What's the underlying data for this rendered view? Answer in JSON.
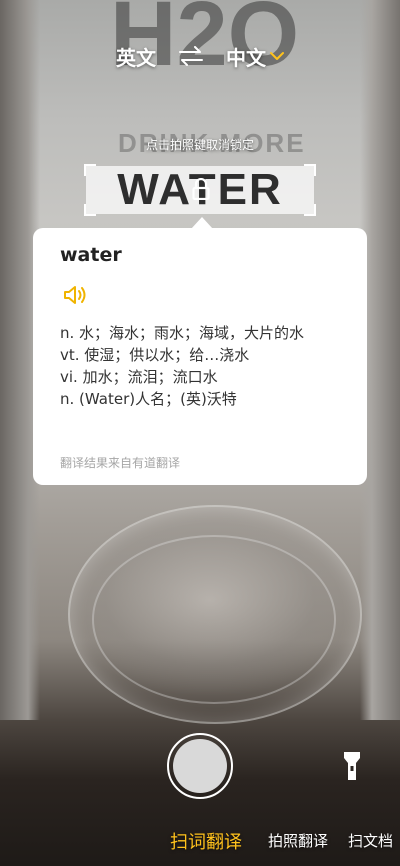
{
  "lang": {
    "source": "英文",
    "target": "中文"
  },
  "hint": "点击拍照键取消锁定",
  "scan_word": "WATER",
  "card": {
    "word": "water",
    "definitions": [
      "n. 水；海水；雨水；海域，大片的水",
      "vt. 使湿；供以水；给…浇水",
      "vi. 加水；流泪；流口水",
      "n. (Water)人名；(英)沃特"
    ],
    "source": "翻译结果来自有道翻译"
  },
  "background_print": {
    "formula": "H2O",
    "top_text": "DRINK MORE"
  },
  "modes": [
    "扫词翻译",
    "拍照翻译",
    "扫文档"
  ],
  "colors": {
    "accent": "#ffc21c"
  }
}
